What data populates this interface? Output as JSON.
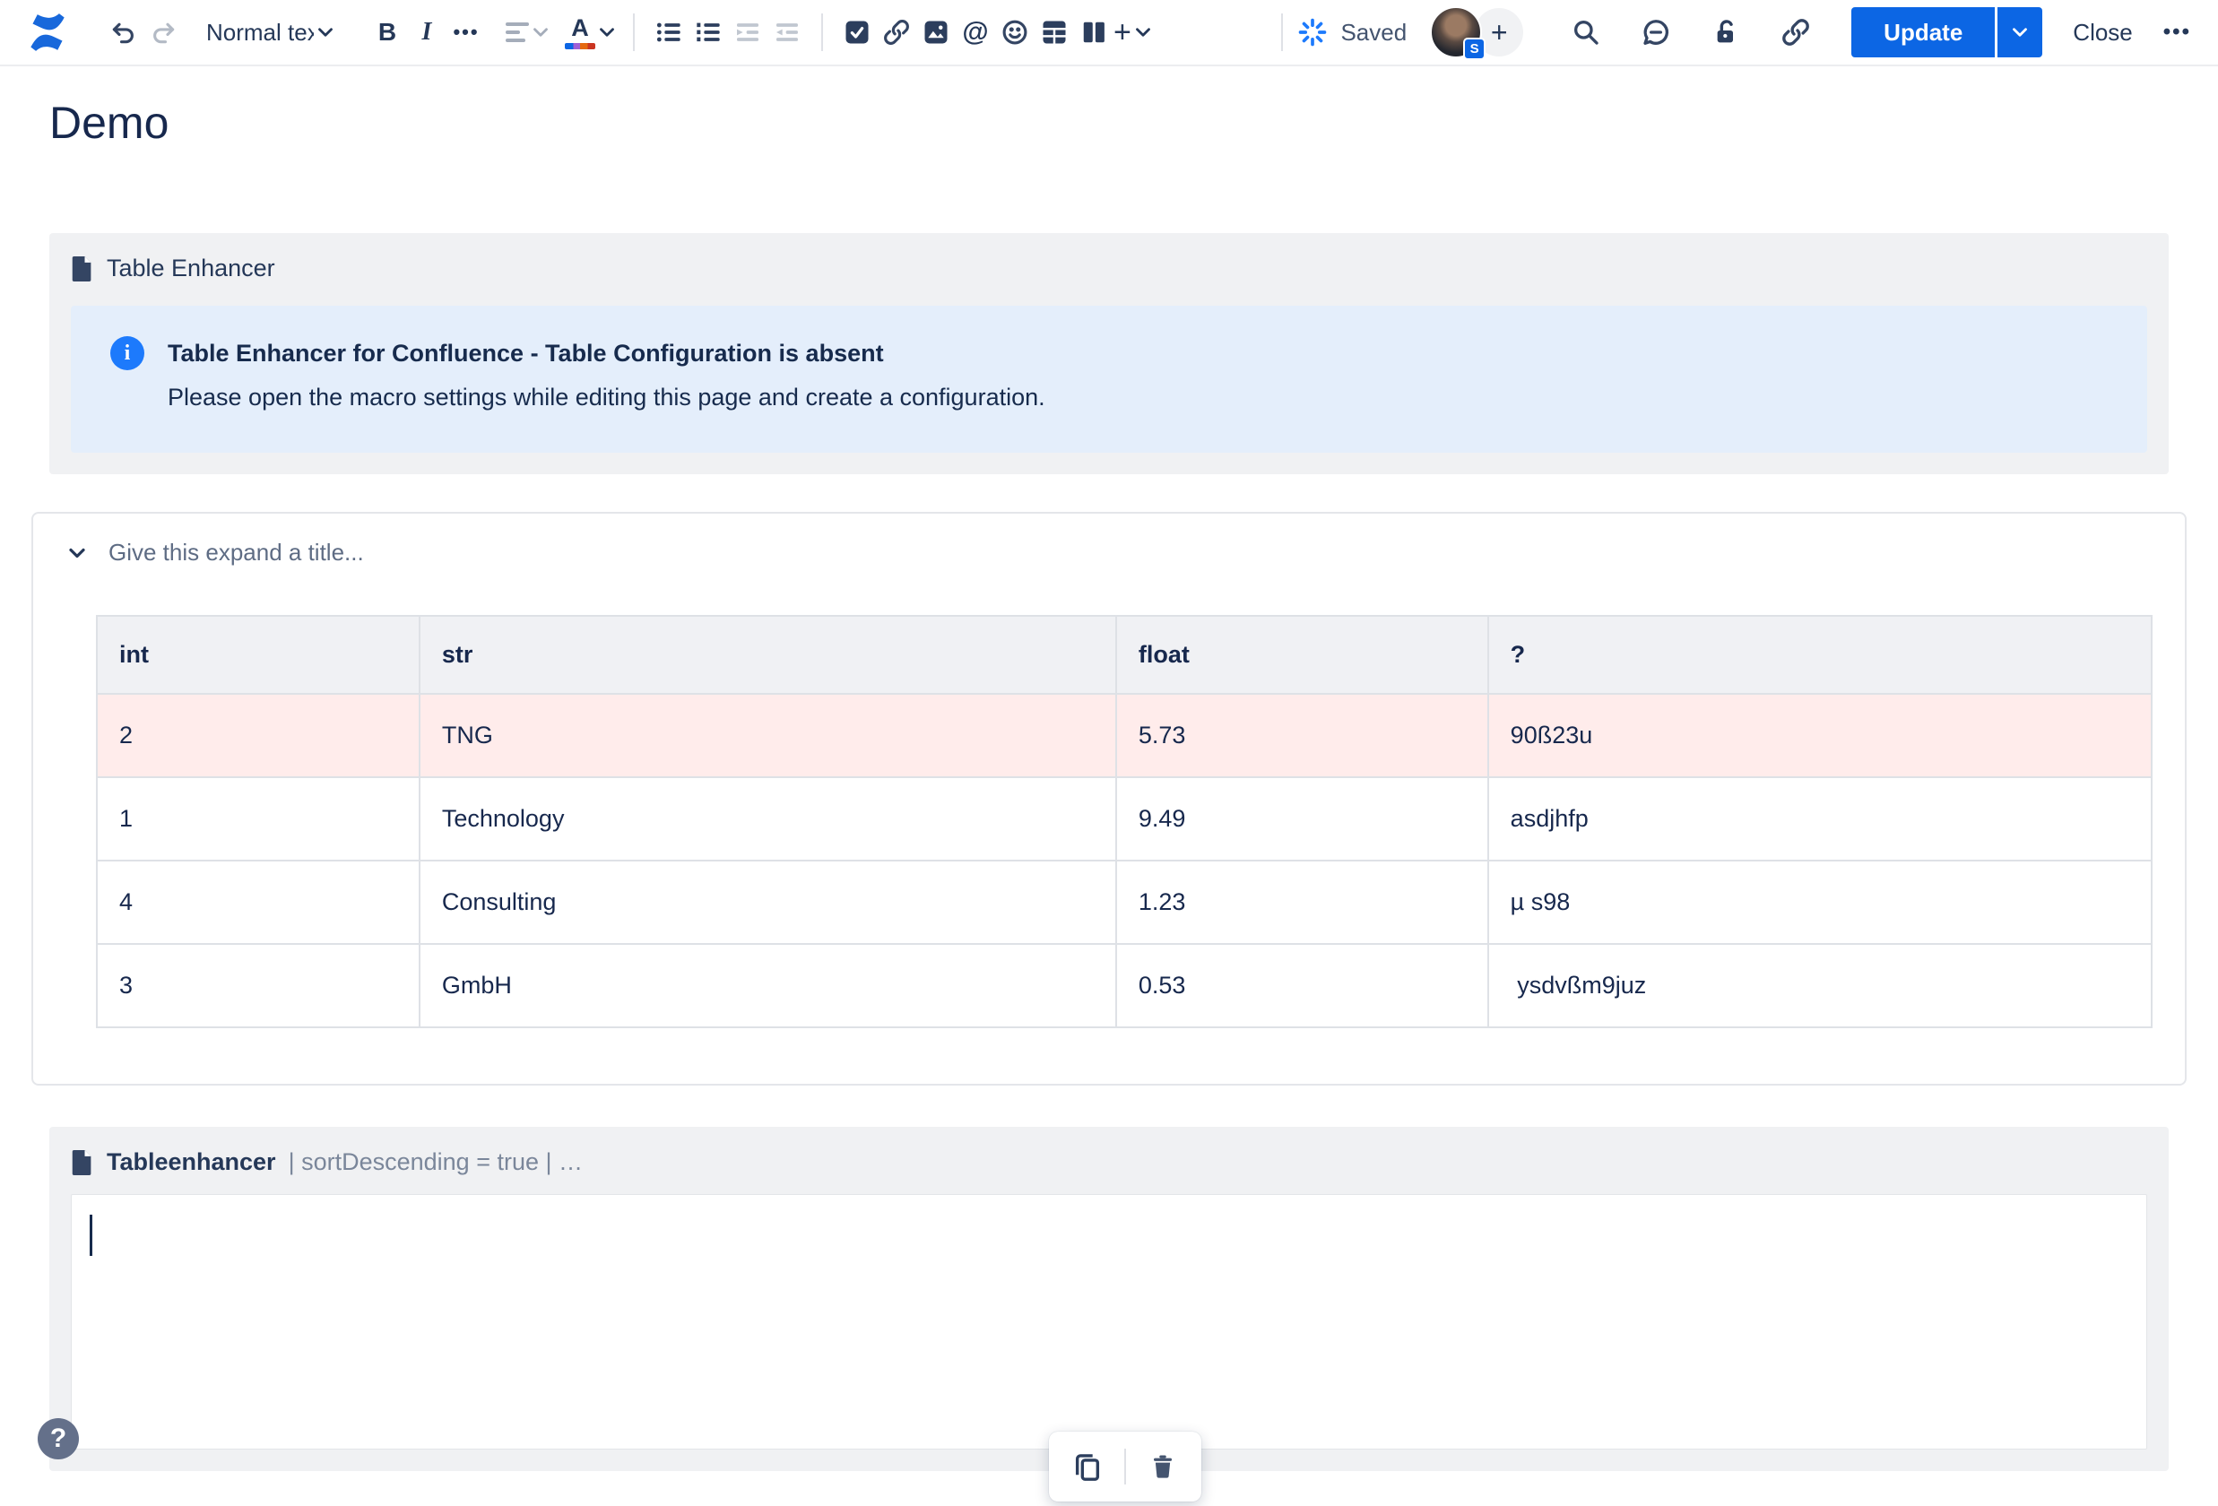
{
  "toolbar": {
    "text_style": "Normal text",
    "saved_label": "Saved",
    "avatar_badge": "S",
    "update_label": "Update",
    "close_label": "Close",
    "glyphs": {
      "bold": "B",
      "italic": "I",
      "more_formatting": "•••",
      "text_color": "A",
      "mention": "@",
      "insert_plus": "+",
      "more_actions": "•••",
      "add_collaborator": "+"
    }
  },
  "page": {
    "title": "Demo"
  },
  "table_enhancer_macro": {
    "name": "Table Enhancer",
    "info": {
      "title": "Table Enhancer for Confluence - Table Configuration is absent",
      "body": "Please open the macro settings while editing this page and create a configuration."
    }
  },
  "expand": {
    "placeholder": "Give this expand a title...",
    "table": {
      "columns": [
        "int",
        "str",
        "float",
        "?"
      ],
      "rows": [
        {
          "cells": [
            "2",
            "TNG",
            "5.73",
            "90ß23u"
          ],
          "highlight": true
        },
        {
          "cells": [
            "1",
            "Technology",
            "9.49",
            "asdjhfp"
          ],
          "highlight": false
        },
        {
          "cells": [
            "4",
            "Consulting",
            "1.23",
            "µ s98"
          ],
          "highlight": false
        },
        {
          "cells": [
            "3",
            "GmbH",
            "0.53",
            " ysdvßm9juz"
          ],
          "highlight": false
        }
      ]
    }
  },
  "tableenhancer_macro": {
    "name": "Tableenhancer",
    "params_text": "| sortDescending = true | …",
    "body_text": ""
  },
  "help": {
    "label": "?"
  },
  "colors": {
    "accent_blue": "#0C66E4",
    "info_icon_blue": "#1D7AFC",
    "info_panel_bg": "#E4EEFB",
    "highlight_row_bg": "#FFECEB",
    "macro_panel_bg": "#F0F1F3",
    "table_header_bg": "#F0F1F4",
    "text_navy": "#172B4D"
  }
}
